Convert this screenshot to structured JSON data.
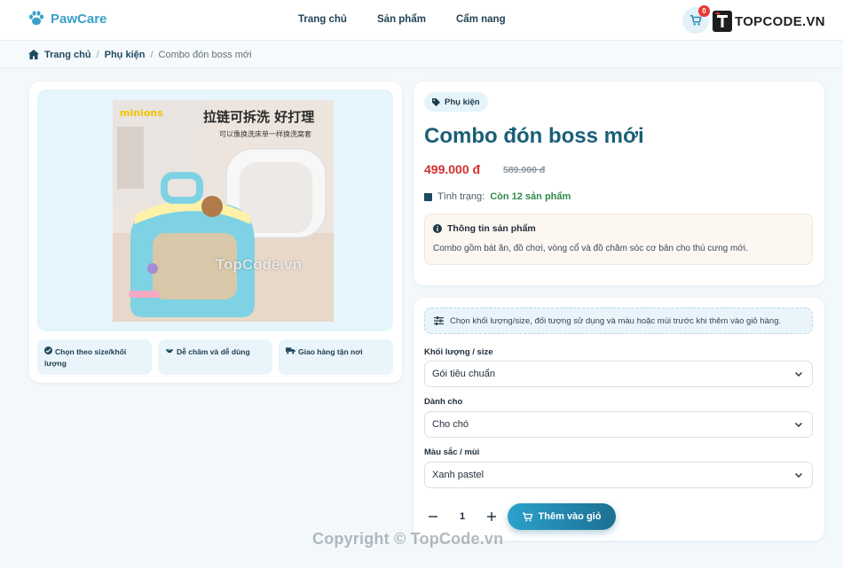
{
  "header": {
    "brand": "PawCare",
    "nav": [
      "Trang chủ",
      "Sản phẩm",
      "Cẩm nang"
    ],
    "cart_count": "0",
    "watermark_logo": "TOPCODE.VN"
  },
  "breadcrumb": {
    "home": "Trang chủ",
    "category": "Phụ kiện",
    "current": "Combo đón boss mới"
  },
  "gallery": {
    "image_text_top": "拉链可拆洗 好打理",
    "image_text_sub": "可以像换洗床单一样换洗窝套",
    "image_brand": "minions",
    "features": [
      {
        "icon": "check-circle-icon",
        "label": "Chọn theo size/khối lượng"
      },
      {
        "icon": "hands-icon",
        "label": "Dễ chăm và dễ dùng"
      },
      {
        "icon": "truck-icon",
        "label": "Giao hàng tận nơi"
      }
    ]
  },
  "product": {
    "category_chip": "Phụ kiện",
    "title": "Combo đón boss mới",
    "price": "499.000 đ",
    "old_price": "589.000 đ",
    "stock_label": "Tình trạng:",
    "stock_value": "Còn 12 sản phẩm",
    "info_title": "Thông tin sản phẩm",
    "info_text": "Combo gồm bát ăn, đồ chơi, vòng cổ và đồ chăm sóc cơ bản cho thú cưng mới."
  },
  "options": {
    "hint": "Chọn khối lượng/size, đối tượng sử dụng và màu hoặc mùi trước khi thêm vào giỏ hàng.",
    "size_label": "Khối lượng / size",
    "size_value": "Gói tiêu chuẩn",
    "for_label": "Dành cho",
    "for_value": "Cho chó",
    "color_label": "Màu sắc / mùi",
    "color_value": "Xanh pastel",
    "quantity": "1",
    "add_to_cart": "Thêm vào giỏ"
  },
  "watermarks": {
    "image": "TopCode.vn",
    "footer": "Copyright © TopCode.vn"
  },
  "colors": {
    "accent": "#3aa0c8",
    "title": "#1a5f77",
    "price": "#d32f2f",
    "stock": "#2e8a4a"
  }
}
